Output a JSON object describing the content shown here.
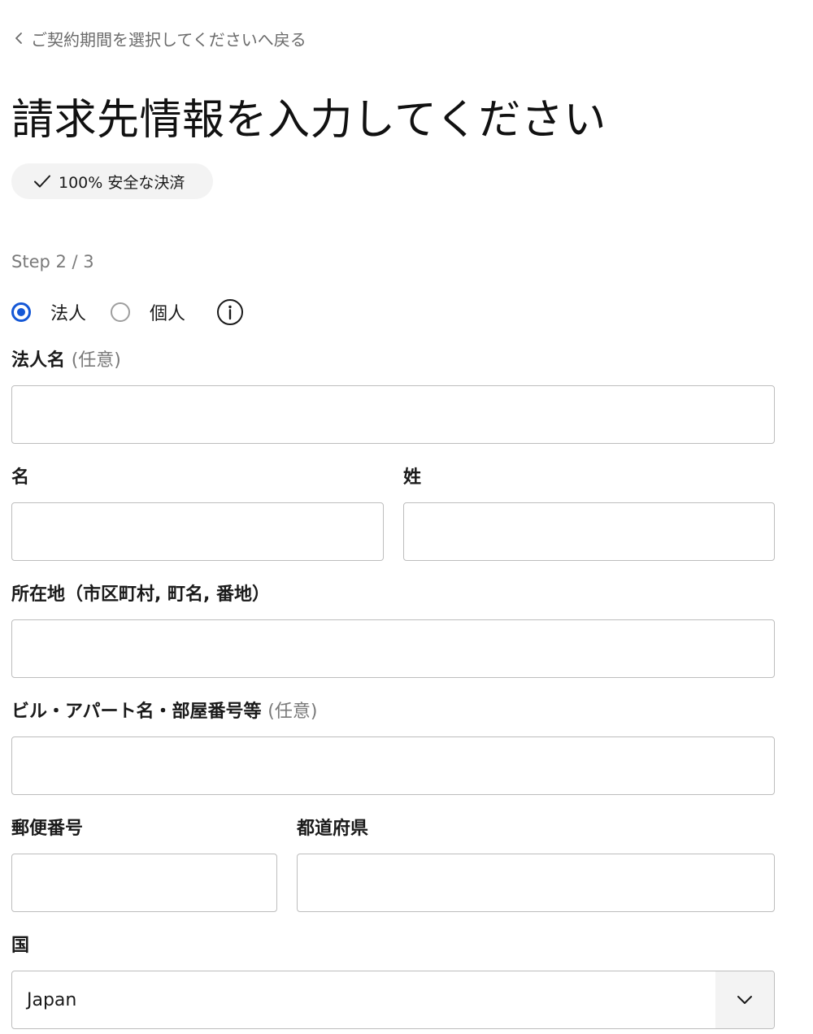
{
  "back_link": {
    "label": "ご契約期間を選択してくださいへ戻る",
    "icon": "chevron-left-icon"
  },
  "title": "請求先情報を入力してください",
  "secure_badge": {
    "label": "100% 安全な決済",
    "icon": "check-icon"
  },
  "step": "Step 2 / 3",
  "customer_type": {
    "options": [
      {
        "label": "法人",
        "selected": true
      },
      {
        "label": "個人",
        "selected": false
      }
    ],
    "info_icon": "info-icon"
  },
  "fields": {
    "company_name": {
      "label": "法人名",
      "optional": "(任意)",
      "value": ""
    },
    "first_name": {
      "label": "名",
      "value": ""
    },
    "last_name": {
      "label": "姓",
      "value": ""
    },
    "address": {
      "label": "所在地（市区町村, 町名, 番地）",
      "value": ""
    },
    "building": {
      "label": "ビル・アパート名・部屋番号等",
      "optional": "(任意)",
      "value": ""
    },
    "postal_code": {
      "label": "郵便番号",
      "value": ""
    },
    "prefecture": {
      "label": "都道府県",
      "value": ""
    },
    "country": {
      "label": "国",
      "value": "Japan"
    }
  },
  "colors": {
    "accent": "#1558d6",
    "muted_text": "#7a7a7a",
    "border": "#bdbdbd",
    "badge_bg": "#f3f3f3"
  }
}
